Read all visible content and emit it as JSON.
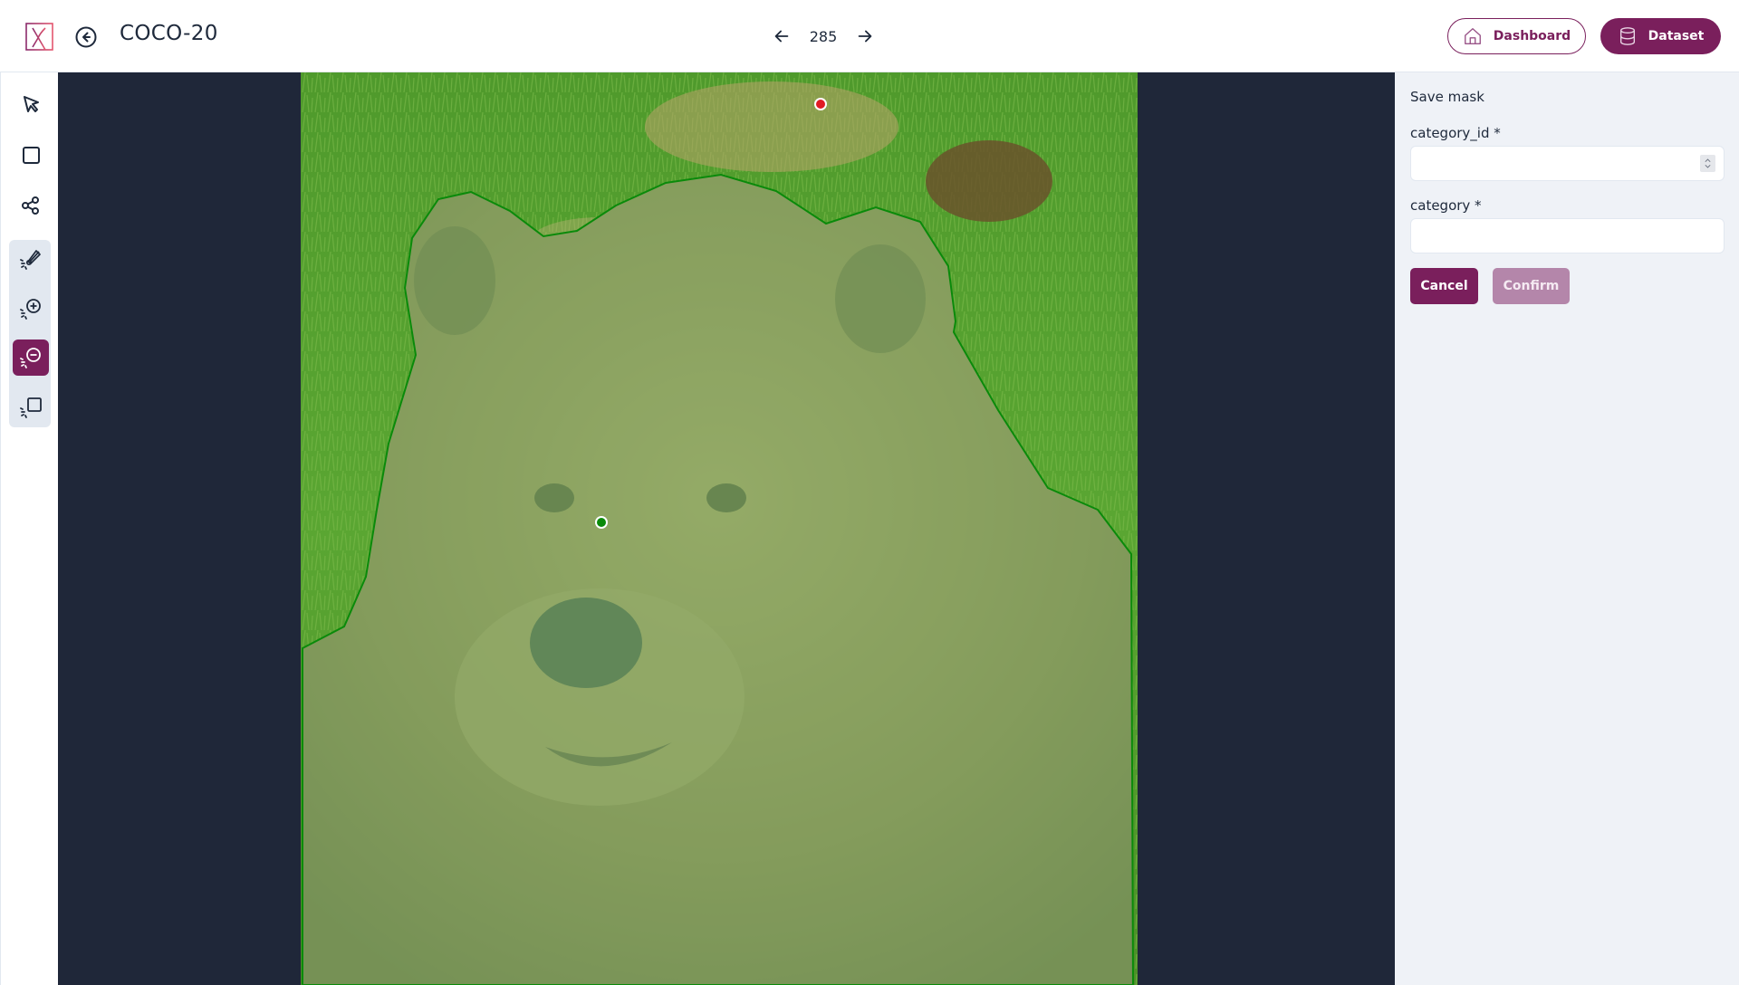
{
  "app": {
    "title": "COCO-20",
    "logo_icon": "x-logo-icon",
    "back_icon": "arrow-left-circle-icon"
  },
  "pager": {
    "current": "285",
    "prev_icon": "arrow-left-icon",
    "next_icon": "arrow-right-icon"
  },
  "nav": {
    "dashboard_label": "Dashboard",
    "dashboard_icon": "home-icon",
    "dataset_label": "Dataset",
    "dataset_icon": "database-icon"
  },
  "tools": [
    {
      "name": "select",
      "icon": "cursor-arrow-icon",
      "active": false
    },
    {
      "name": "bounding-box",
      "icon": "square-icon",
      "active": false
    },
    {
      "name": "keypoints",
      "icon": "share-nodes-icon",
      "active": false
    },
    {
      "name": "smart-brush",
      "icon": "magic-brush-icon",
      "active": false
    },
    {
      "name": "smart-add-point",
      "icon": "magic-plus-circle-icon",
      "active": false
    },
    {
      "name": "smart-remove-point",
      "icon": "magic-minus-circle-icon",
      "active": true
    },
    {
      "name": "smart-box",
      "icon": "magic-square-icon",
      "active": false
    }
  ],
  "canvas": {
    "image_subject": "brown bear on grass",
    "mask_color": "#8bd17c",
    "mask_outline_color": "#0a8a0a",
    "points": [
      {
        "type": "negative",
        "color": "#e01b24"
      },
      {
        "type": "positive",
        "color": "#0a8a0a"
      }
    ]
  },
  "panel": {
    "title": "Save mask",
    "fields": [
      {
        "label": "category_id *",
        "value": "",
        "type": "number"
      },
      {
        "label": "category *",
        "value": "",
        "type": "text"
      }
    ],
    "cancel_label": "Cancel",
    "confirm_label": "Confirm",
    "confirm_disabled": true
  },
  "colors": {
    "brand": "#7a1f5c",
    "brand_disabled": "#b486aa",
    "canvas_bg": "#1f2739",
    "panel_bg": "#eff2f7"
  }
}
